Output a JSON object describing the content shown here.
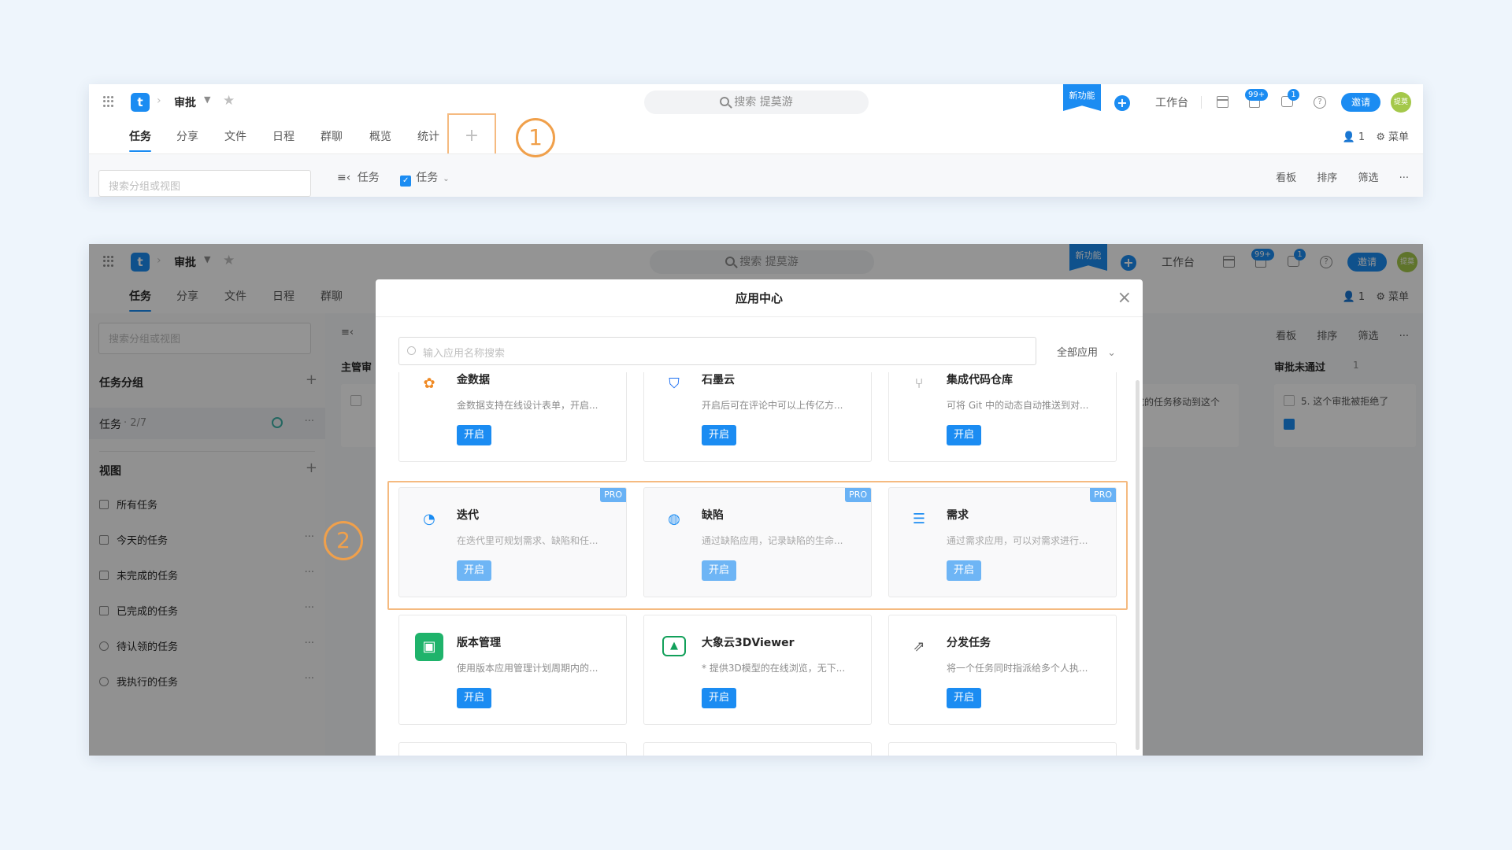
{
  "header": {
    "project": "审批",
    "search_placeholder": "搜索 提莫游",
    "new_feature": "新功能",
    "workbench": "工作台",
    "notif_badge": "99+",
    "msg_badge": "1",
    "invite": "邀请",
    "avatar_text": "提莫",
    "logo_letter": "t"
  },
  "tabs": [
    "任务",
    "分享",
    "文件",
    "日程",
    "群聊",
    "概览",
    "统计"
  ],
  "add_tab": "+",
  "tabs_right": {
    "members": "1",
    "menu": "菜单"
  },
  "filterbar": {
    "side_search_placeholder": "搜索分组或视图",
    "left_label": "任务",
    "check_label": "任务",
    "kanban": "看板",
    "sort": "排序",
    "filter": "筛选",
    "more": "···"
  },
  "callouts": [
    "1",
    "2"
  ],
  "sidebar": {
    "group_title": "任务分组",
    "group_item": "任务",
    "group_count": "· 2/7",
    "views_title": "视图",
    "views": [
      "所有任务",
      "今天的任务",
      "未完成的任务",
      "已完成的任务",
      "待认领的任务",
      "我执行的任务"
    ]
  },
  "board": {
    "col1_title": "主管审",
    "col3_title": "审批未通过",
    "col3_count": "1",
    "col2_text": "成的任务移动到这个",
    "col3_card": "5. 这个审批被拒绝了"
  },
  "modal": {
    "title": "应用中心",
    "search_placeholder": "输入应用名称搜索",
    "filter": "全部应用",
    "button_label": "开启",
    "pro_label": "PRO",
    "apps": [
      {
        "name": "金数据",
        "desc": "金数据支持在线设计表单，开启...",
        "icon": "form-icon",
        "color": "#f08a24"
      },
      {
        "name": "石墨云",
        "desc": "开启后可在评论中可以上传亿方...",
        "icon": "shield-icon",
        "color": "#1b6ef2"
      },
      {
        "name": "集成代码仓库",
        "desc": "可将 Git 中的动态自动推送到对...",
        "icon": "git-icon",
        "color": "#8c8c8c"
      },
      {
        "name": "迭代",
        "desc": "在迭代里可规划需求、缺陷和任...",
        "icon": "iteration-icon",
        "color": "#1b8cf2",
        "pro": true
      },
      {
        "name": "缺陷",
        "desc": "通过缺陷应用，记录缺陷的生命...",
        "icon": "bug-icon",
        "color": "#1b8cf2",
        "pro": true
      },
      {
        "name": "需求",
        "desc": "通过需求应用，可以对需求进行...",
        "icon": "requirement-icon",
        "color": "#1b8cf2",
        "pro": true
      },
      {
        "name": "版本管理",
        "desc": "使用版本应用管理计划周期内的...",
        "icon": "version-icon",
        "color": "#1fb36b"
      },
      {
        "name": "大象云3DViewer",
        "desc": "* 提供3D模型的在线浏览，无下...",
        "icon": "3d-viewer-icon",
        "color": "#12a05a"
      },
      {
        "name": "分发任务",
        "desc": "将一个任务同时指派给多个人执...",
        "icon": "distribute-icon",
        "color": "#595959"
      }
    ]
  }
}
